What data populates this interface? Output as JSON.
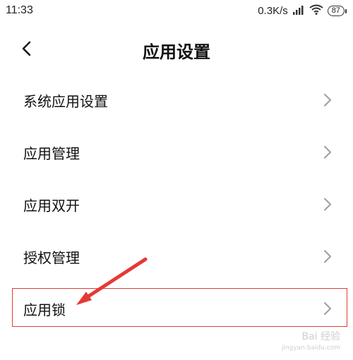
{
  "status_bar": {
    "time": "11:33",
    "network_speed": "0.3K/s",
    "battery": "87"
  },
  "header": {
    "title": "应用设置"
  },
  "settings": [
    {
      "label": "系统应用设置"
    },
    {
      "label": "应用管理"
    },
    {
      "label": "应用双开"
    },
    {
      "label": "授权管理"
    },
    {
      "label": "应用锁"
    }
  ],
  "icons": {
    "back": "back-chevron-icon",
    "chevron": "chevron-right-icon",
    "signal": "signal-icon",
    "wifi": "wifi-icon",
    "battery": "battery-icon"
  },
  "colors": {
    "highlight": "#e53935",
    "arrow": "#e53935",
    "chevron": "#9e9e9e",
    "text": "#111111"
  },
  "watermark": {
    "brand": "Bai 经验",
    "url": "jingyan.baidu.com"
  }
}
